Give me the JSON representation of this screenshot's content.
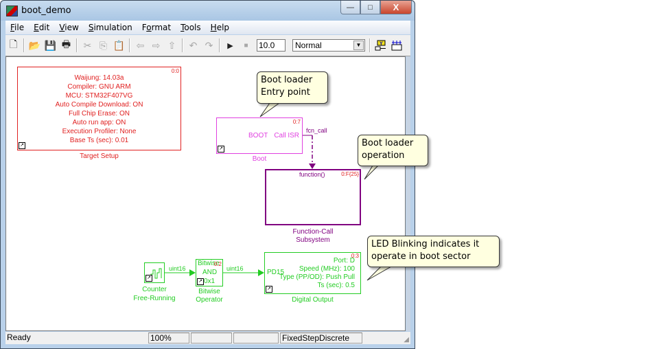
{
  "window": {
    "title": "boot_demo",
    "buttons": {
      "minimize": "—",
      "maximize": "□",
      "close": "X"
    }
  },
  "menu": [
    {
      "label": "File",
      "accel": "F",
      "rest": "ile"
    },
    {
      "label": "Edit",
      "accel": "E",
      "rest": "dit"
    },
    {
      "label": "View",
      "accel": "V",
      "rest": "iew"
    },
    {
      "label": "Simulation",
      "accel": "S",
      "rest": "imulation"
    },
    {
      "label": "Format",
      "accel": "F",
      "pre": "F",
      "mid": "o",
      "rest": "rmat"
    },
    {
      "label": "Tools",
      "accel": "T",
      "rest": "ools"
    },
    {
      "label": "Help",
      "accel": "H",
      "rest": "elp"
    }
  ],
  "toolbar": {
    "icons": [
      "new-file-icon",
      "open-folder-icon",
      "save-icon",
      "print-icon",
      "cut-icon",
      "copy-icon",
      "paste-icon",
      "back-arrow-icon",
      "forward-arrow-icon",
      "up-arrow-icon",
      "undo-icon",
      "redo-icon",
      "play-icon",
      "stop-icon",
      "library-browser-icon",
      "model-explorer-icon"
    ],
    "stop_time": "10.0",
    "sim_mode": "Normal"
  },
  "blocks": {
    "target_setup": {
      "lines": [
        "Waijung: 14.03a",
        "Compiler: GNU ARM",
        "MCU: STM32F407VG",
        "Auto Compile Download: ON",
        "Full Chip Erase: ON",
        "Auto run app: ON",
        "Execution Profiler: None",
        "Base Ts (sec): 0.01"
      ],
      "priority": "0:0",
      "label": "Target Setup",
      "color": "#e02020"
    },
    "boot": {
      "text_left": "BOOT",
      "text_port": "Call ISR",
      "priority": "0:7",
      "label": "Boot",
      "signal": "fcn_call",
      "color": "#e040e0"
    },
    "function_call": {
      "port": "function()",
      "priority": "0:F{25}",
      "label1": "Function-Call",
      "label2": "Subsystem",
      "color": "#800080"
    },
    "counter": {
      "label1": "Counter",
      "label2": "Free-Running",
      "signal": "uint16",
      "color": "#22cc22"
    },
    "bitwise": {
      "line1": "Bitwise",
      "line2": "AND",
      "line3": "0x1",
      "priority": "0:2",
      "label1": "Bitwise",
      "label2": "Operator",
      "signal": "uint16"
    },
    "digital_output": {
      "port_in": "PD15",
      "lines": [
        "Port: D",
        "Speed (MHz): 100",
        "Type (PP/OD): Push Pull",
        "Ts (sec): 0.5"
      ],
      "priority": "0:3",
      "label": "Digital Output"
    }
  },
  "callouts": {
    "entry": [
      "Boot loader",
      "Entry point"
    ],
    "operation": [
      "Boot loader",
      "operation"
    ],
    "led": [
      "LED Blinking indicates it",
      "operate in boot sector"
    ]
  },
  "statusbar": {
    "status": "Ready",
    "zoom": "100%",
    "field3": "",
    "field4": "",
    "solver": "FixedStepDiscrete"
  }
}
